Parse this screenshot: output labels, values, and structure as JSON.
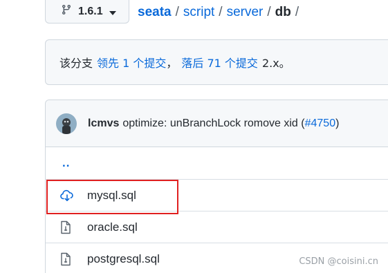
{
  "branch": {
    "name": "1.6.1",
    "icon": "git-branch-icon",
    "caret_icon": "triangle-down-icon"
  },
  "breadcrumb": {
    "items": [
      "seata",
      "script",
      "server"
    ],
    "separator": "/",
    "current": "db",
    "trailing": "/"
  },
  "branch_info": {
    "prefix": "该分支",
    "ahead": "领先 1 个提交",
    "comma": "，",
    "behind": "落后 71 个提交",
    "suffix": "2.x。"
  },
  "commit": {
    "author": "lcmvs",
    "message": "optimize: unBranchLock romove xid (",
    "pr_link": "#4750",
    "close": ")"
  },
  "files": {
    "parent": "..",
    "items": [
      {
        "name": "mysql.sql",
        "icon": "cloud-download-icon",
        "highlighted": true
      },
      {
        "name": "oracle.sql",
        "icon": "file-icon",
        "highlighted": false
      },
      {
        "name": "postgresql.sql",
        "icon": "file-icon",
        "highlighted": false
      }
    ]
  },
  "watermark": "CSDN @coisini.cn",
  "colors": {
    "link": "#0969da",
    "highlight_border": "#e02020",
    "box_bg": "#f6f8fa"
  }
}
